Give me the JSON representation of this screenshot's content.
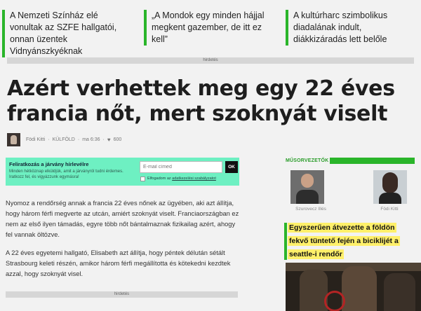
{
  "top_links": [
    {
      "text": "A Nemzeti Színház elé vonultak az SZFE hallgatói, onnan üzentek Vidnyánszkyéknak"
    },
    {
      "text": "„A Mondok egy minden hájjal megkent gazember, de itt ez kell”"
    },
    {
      "text": "A kultúrharc szimbolikus diadalának indult, diákkizáradás lett belőle"
    }
  ],
  "ads": {
    "top_label": "hirdetés",
    "mid_label": "hirdetés"
  },
  "article": {
    "headline": "Azért verhettek meg egy 22 éves francia nőt, mert szoknyát viselt",
    "author": "Födi Kitti",
    "section": "KÜLFÖLD",
    "time": "ma 6:36",
    "likes": "600",
    "paragraphs": [
      "Nyomoz a rendőrség annak a francia 22 éves nőnek az ügyében, aki azt állítja, hogy három férfi megverte az utcán, amiért szoknyát viselt. Franciaországban ez nem az első ilyen támadás, egyre több nőt bántalmaznak fizikailag azért, ahogy fel vannak öltözve.",
      "A 22 éves egyetemi hallgató, Elisabeth azt állítja, hogy péntek délután sétált Strasbourg keleti részén, amikor három férfi megállította és kötekedni kezdtek azzal, hogy szoknyát visel."
    ]
  },
  "newsletter": {
    "title": "Feliratkozás a járvány hírlevélre",
    "description": "Minden hétköznap elküldjük, amit a járványról tudni érdemes. Iratkozz fel, és vigyázzunk egymásra!",
    "email_placeholder": "E-mail címed",
    "submit_label": "OK",
    "consent_prefix": "Elfogadom az ",
    "consent_link": "adatkezelési szabályzatot"
  },
  "sidebar": {
    "label": "MŰSORVEZETŐK",
    "hosts": [
      {
        "name": "Szurovecz Illés"
      },
      {
        "name": "Födi Kitti"
      }
    ],
    "feature_title": "Egyszerűen átvezette a földön fekvő tüntető fején a biciklijét a seattle-i rendőr"
  },
  "colors": {
    "accent_green": "#2ab52a",
    "newsletter_bg": "#6ef0c2",
    "highlight_yellow": "#fff06a"
  },
  "icons": {
    "likes": "heart-icon"
  }
}
